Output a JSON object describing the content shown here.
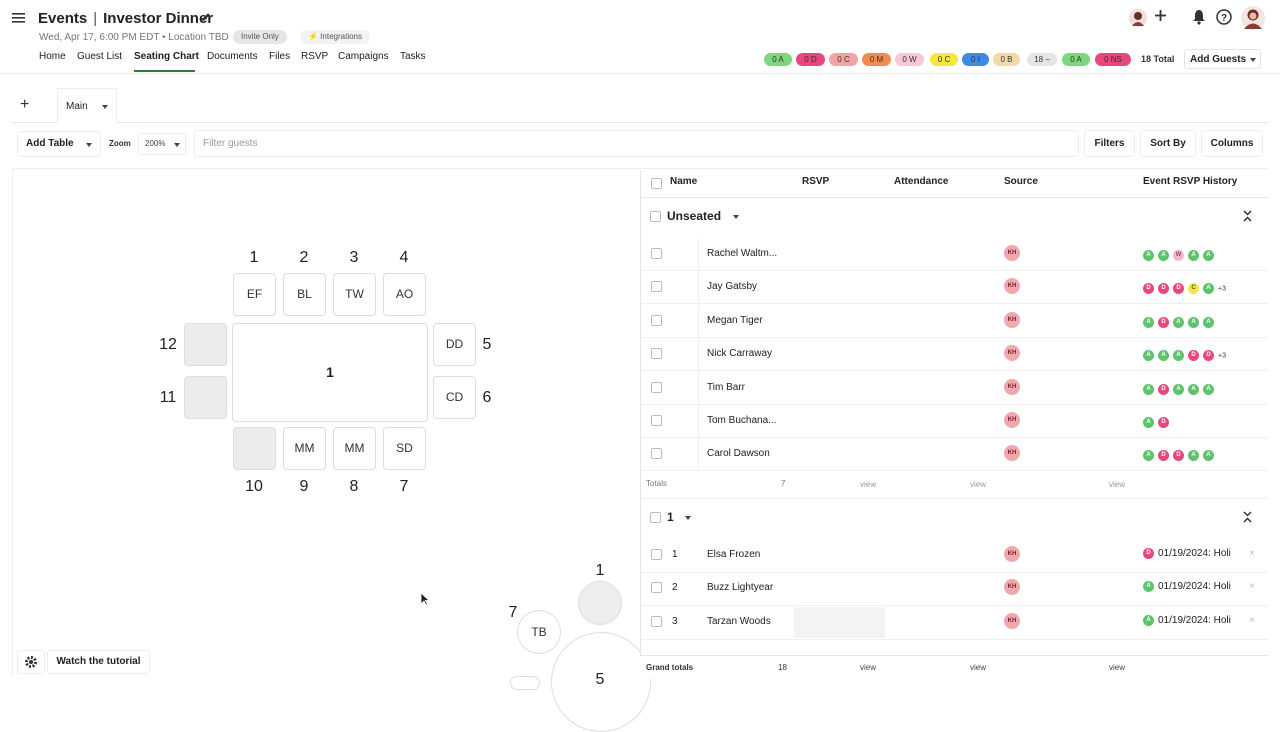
{
  "header": {
    "crumb_root": "Events",
    "crumb_sep": "|",
    "event_name": "Investor Dinner",
    "subtitle": "Wed, Apr 17, 6:00 PM EDT • Location TBD",
    "invite_chip": "Invite Only",
    "integrations_chip": "⚡ Integrations"
  },
  "nav": [
    "Home",
    "Guest List",
    "Seating Chart",
    "Documents",
    "Files",
    "RSVP",
    "Campaigns",
    "Tasks"
  ],
  "status_pills": [
    {
      "label": "0 A",
      "bg": "#7ed67e"
    },
    {
      "label": "0 D",
      "bg": "#e8467c"
    },
    {
      "label": "0 C",
      "bg": "#f4a3a3"
    },
    {
      "label": "0 M",
      "bg": "#f28b50"
    },
    {
      "label": "0 W",
      "bg": "#f7c6d9"
    },
    {
      "label": "0 C",
      "bg": "#f5e642"
    },
    {
      "label": "0 I",
      "bg": "#3d8be8"
    },
    {
      "label": "0 B",
      "bg": "#f4d9a8"
    },
    {
      "label": "18 –",
      "bg": "#e5e5e5"
    },
    {
      "label": "0 A",
      "bg": "#7ed67e"
    },
    {
      "label": "0 NS",
      "bg": "#e8467c"
    }
  ],
  "total_label": "18 Total",
  "add_guests": "Add Guests",
  "tabs": {
    "plus": "+",
    "main": "Main"
  },
  "toolbar": {
    "add_table": "Add Table",
    "zoom_label": "Zoom",
    "zoom_value": "200%",
    "filter_placeholder": "Filter guests",
    "filters": "Filters",
    "sort_by": "Sort By",
    "columns": "Columns"
  },
  "seating": {
    "table_label": "1",
    "top_seats": [
      {
        "n": "1",
        "i": "EF"
      },
      {
        "n": "2",
        "i": "BL"
      },
      {
        "n": "3",
        "i": "TW"
      },
      {
        "n": "4",
        "i": "AO"
      }
    ],
    "right_seats": [
      {
        "n": "5",
        "i": "DD"
      },
      {
        "n": "6",
        "i": "CD"
      }
    ],
    "bottom_seats": [
      {
        "n": "10",
        "i": ""
      },
      {
        "n": "9",
        "i": "MM"
      },
      {
        "n": "8",
        "i": "MM"
      },
      {
        "n": "7",
        "i": "SD"
      }
    ],
    "left_seats": [
      {
        "n": "12",
        "i": ""
      },
      {
        "n": "11",
        "i": ""
      }
    ],
    "round_table": {
      "seat_num_top": "1",
      "seat_num_left": "7",
      "seat_initials": "TB",
      "table_label": "5"
    }
  },
  "footer": {
    "tutorial": "Watch the tutorial"
  },
  "grid": {
    "columns": [
      "Name",
      "RSVP",
      "Attendance",
      "Source",
      "Event RSVP History"
    ],
    "unseated_title": "Unseated",
    "unseated": [
      {
        "name": "Rachel Waltm...",
        "source": "KH",
        "history": [
          "A",
          "A",
          "W",
          "A",
          "A"
        ],
        "more": ""
      },
      {
        "name": "Jay Gatsby",
        "source": "KH",
        "history": [
          "D",
          "D",
          "D",
          "C",
          "A"
        ],
        "more": "+3"
      },
      {
        "name": "Megan Tiger",
        "source": "KH",
        "history": [
          "A",
          "D",
          "A",
          "A",
          "A"
        ],
        "more": ""
      },
      {
        "name": "Nick Carraway",
        "source": "KH",
        "history": [
          "A",
          "A",
          "A",
          "D",
          "D"
        ],
        "more": "+3"
      },
      {
        "name": "Tim Barr",
        "source": "KH",
        "history": [
          "A",
          "D",
          "A",
          "A",
          "A"
        ],
        "more": ""
      },
      {
        "name": "Tom Buchana...",
        "source": "KH",
        "history": [
          "A",
          "D"
        ],
        "more": ""
      },
      {
        "name": "Carol Dawson",
        "source": "KH",
        "history": [
          "A",
          "D",
          "D",
          "A",
          "A"
        ],
        "more": ""
      }
    ],
    "totals_label": "Totals",
    "totals_count": "7",
    "view": "view",
    "group_title": "1",
    "group_rows": [
      {
        "seat": "1",
        "name": "Elsa Frozen",
        "source": "KH",
        "dot": "D",
        "history": "01/19/2024: Holi"
      },
      {
        "seat": "2",
        "name": "Buzz Lightyear",
        "source": "KH",
        "dot": "A",
        "history": "01/19/2024: Holi"
      },
      {
        "seat": "3",
        "name": "Tarzan Woods",
        "source": "KH",
        "dot": "A",
        "history": "01/19/2024: Holi"
      }
    ],
    "grand_totals_label": "Grand totals",
    "grand_totals_count": "18"
  },
  "colors": {
    "A": "#5ec46b",
    "D": "#e8467c",
    "W": "#f4b6cf",
    "C": "#f5e642",
    "accent": "#2e7d32"
  }
}
